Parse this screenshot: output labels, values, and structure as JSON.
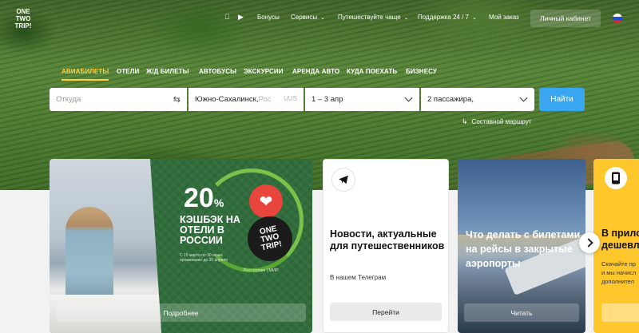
{
  "logo": {
    "line1": "ONE",
    "line2": "TWO",
    "line3": "TRIP!"
  },
  "topnav": {
    "apple_icon": "apple-icon",
    "play_icon": "google-play-icon",
    "bonuses": "Бонусы",
    "services": "Сервисы",
    "travel_more": "Путешествуйте чаще",
    "support": "Поддержка 24 / 7",
    "my_order": "Мой заказ",
    "cabinet": "Личный кабинет",
    "language_icon": "russia-flag-icon"
  },
  "tabs": [
    "АВИАБИЛЕТЫ",
    "ОТЕЛИ",
    "Ж/Д БИЛЕТЫ",
    "АВТОБУСЫ",
    "ЭКСКУРСИИ",
    "АРЕНДА АВТО",
    "КУДА ПОЕХАТЬ",
    "БИЗНЕСУ"
  ],
  "search": {
    "from_placeholder": "Откуда",
    "to_value": "Южно-Сахалинск,",
    "to_hint": " Рос",
    "to_code": "UUS",
    "dates": "1 – 3 апр",
    "passengers": "2 пассажира,",
    "find": "Найти",
    "route_link": "Составной маршрут"
  },
  "cards": {
    "promo": {
      "percent": "20",
      "percent_sign": "%",
      "headline": "КЭШБЭК НА ОТЕЛИ В РОССИИ",
      "small_print": "С 15 марта по 30 июня, проживание до 30 апреля",
      "partners": "Ростуризм  |  МИР",
      "badge_line1": "ONE",
      "badge_line2": "TWO",
      "badge_line3": "TRIP!",
      "button": "Подробнее"
    },
    "telegram": {
      "title": "Новости, актуальные для путешественников",
      "subtitle": "В нашем Телеграм",
      "button": "Перейти"
    },
    "airports": {
      "title": "Что делать с билетами на рейсы в закрытые аэропорты",
      "button": "Читать"
    },
    "app": {
      "title": "В прило",
      "title2": "дешевл",
      "sub1": "Скачайте пр",
      "sub2": "и мы начисл",
      "sub3": "дополнител"
    }
  }
}
